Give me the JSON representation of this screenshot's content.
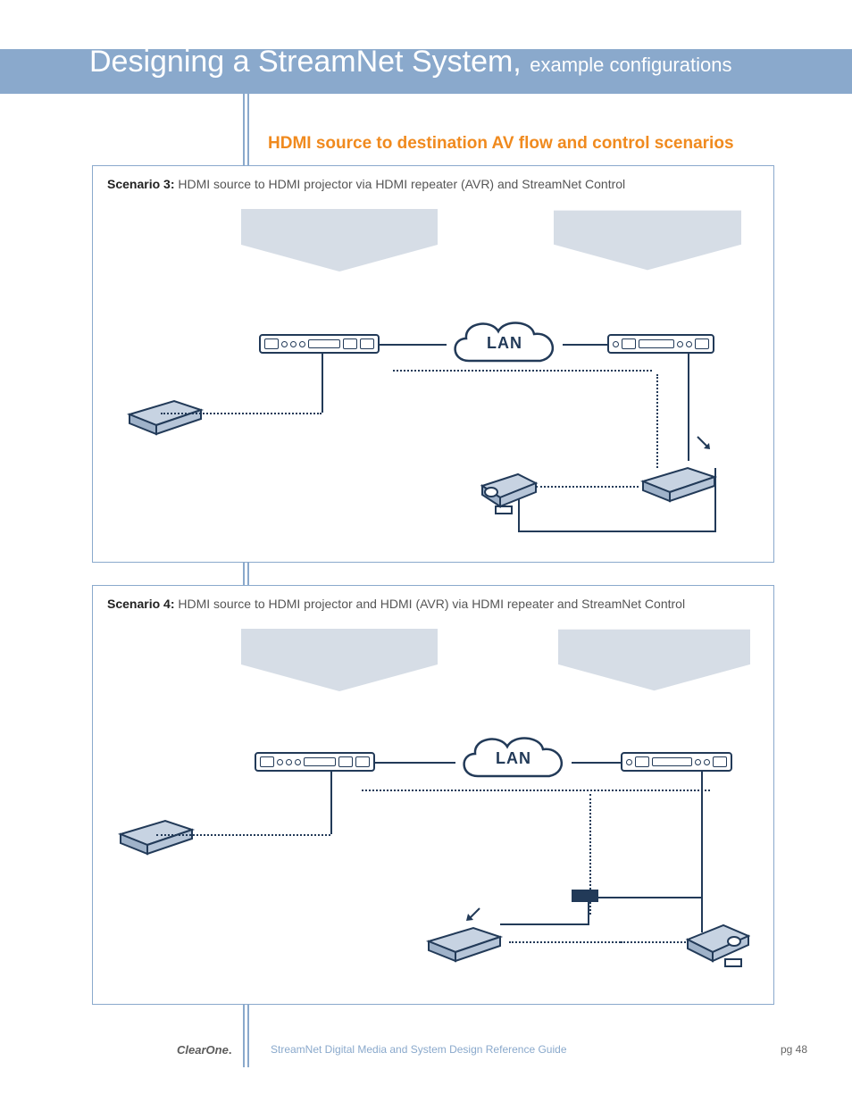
{
  "header": {
    "title_main": "Designing a StreamNet System,",
    "title_sub": "example configurations"
  },
  "section_title": "HDMI source to destination AV flow and control scenarios",
  "scenarios": [
    {
      "label": "Scenario 3:",
      "text": "HDMI source to HDMI projector via HDMI repeater (AVR) and StreamNet Control",
      "lan_label": "LAN"
    },
    {
      "label": "Scenario 4:",
      "text": "HDMI source to HDMI projector and HDMI (AVR) via HDMI repeater and StreamNet Control",
      "lan_label": "LAN"
    }
  ],
  "footer": {
    "logo": "ClearOne",
    "doc_title": "StreamNet Digital Media and System Design Reference Guide",
    "page": "pg 48"
  },
  "colors": {
    "band": "#8aa9cc",
    "accent": "#f08a1e",
    "ink": "#223a58"
  }
}
